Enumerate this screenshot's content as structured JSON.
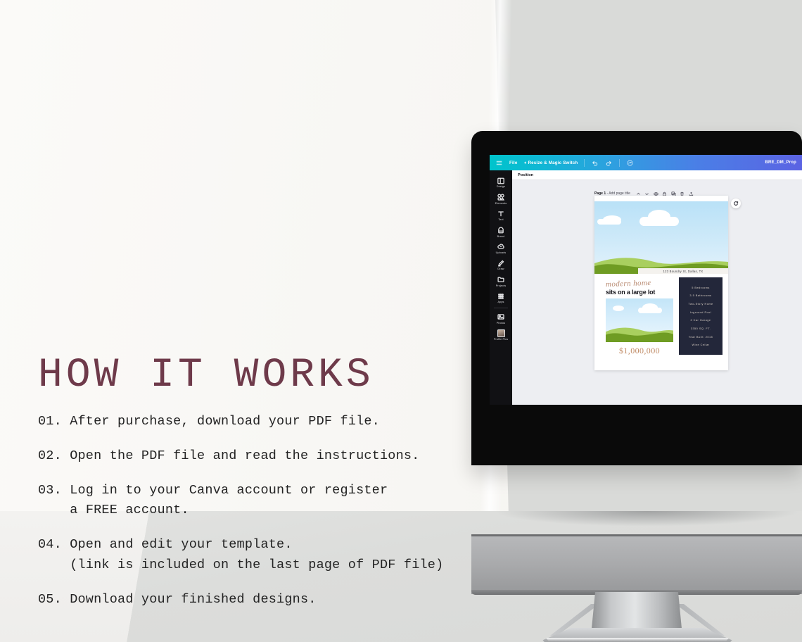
{
  "headline": "HOW IT WORKS",
  "steps": [
    "01. After purchase, download your PDF file.",
    "02. Open the PDF file and read the instructions.",
    "03. Log in to your Canva account or register\n    a FREE account.",
    "04. Open and edit your template.\n    (link is included on the last page of PDF file)",
    "05. Download your finished designs."
  ],
  "colors": {
    "headline": "#6e3a4a",
    "body_text": "#232323",
    "page_background": "#fbfaf8",
    "wall": "#d9dad8",
    "toolbar_gradient_start": "#00c4cc",
    "toolbar_gradient_end": "#5b63e3",
    "sidebar": "#111114",
    "spec_panel": "#23273a",
    "price": "#c08a64",
    "script": "#b98b72"
  },
  "canva": {
    "topbar": {
      "menu_icon": "hamburger-icon",
      "file_label": "File",
      "resize_label": "Resize & Magic Switch",
      "undo_icon": "undo-icon",
      "redo_icon": "redo-icon",
      "cloud_icon": "cloud-sync-icon",
      "filename": "BRE_DM_Prop"
    },
    "sidebar": [
      {
        "label": "Design",
        "icon": "layout-icon"
      },
      {
        "label": "Elements",
        "icon": "shapes-icon"
      },
      {
        "label": "Text",
        "icon": "text-icon"
      },
      {
        "label": "Brand",
        "icon": "brand-icon"
      },
      {
        "label": "Uploads",
        "icon": "upload-cloud-icon"
      },
      {
        "label": "Draw",
        "icon": "pen-icon"
      },
      {
        "label": "Projects",
        "icon": "folder-icon"
      },
      {
        "label": "Apps",
        "icon": "grid-icon"
      },
      {
        "label": "Photos",
        "icon": "photo-icon"
      },
      {
        "label": "Profile Pics",
        "icon": "avatar-icon"
      }
    ],
    "position_bar": {
      "label": "Position"
    },
    "page_header": {
      "page_label": "Page 1",
      "title_placeholder": "- Add page title",
      "icons": [
        "chevron-up-icon",
        "chevron-down-icon",
        "eye-icon",
        "lock-icon",
        "duplicate-icon",
        "trash-icon",
        "export-icon"
      ]
    },
    "refresh_icon": "refresh-icon"
  },
  "design": {
    "address": "123 Boundry St, Dallas, TX",
    "script_line": "modern home",
    "tagline": "sits on a large lot",
    "price": "$1,000,000",
    "specs": [
      "5 Bedrooms",
      "3.5 Bathrooms",
      "Two-Story Home",
      "Inground Pool",
      "2 Car Garage",
      "3350 SQ. FT.",
      "Year Built: 2015",
      "Wine Cellar"
    ]
  }
}
